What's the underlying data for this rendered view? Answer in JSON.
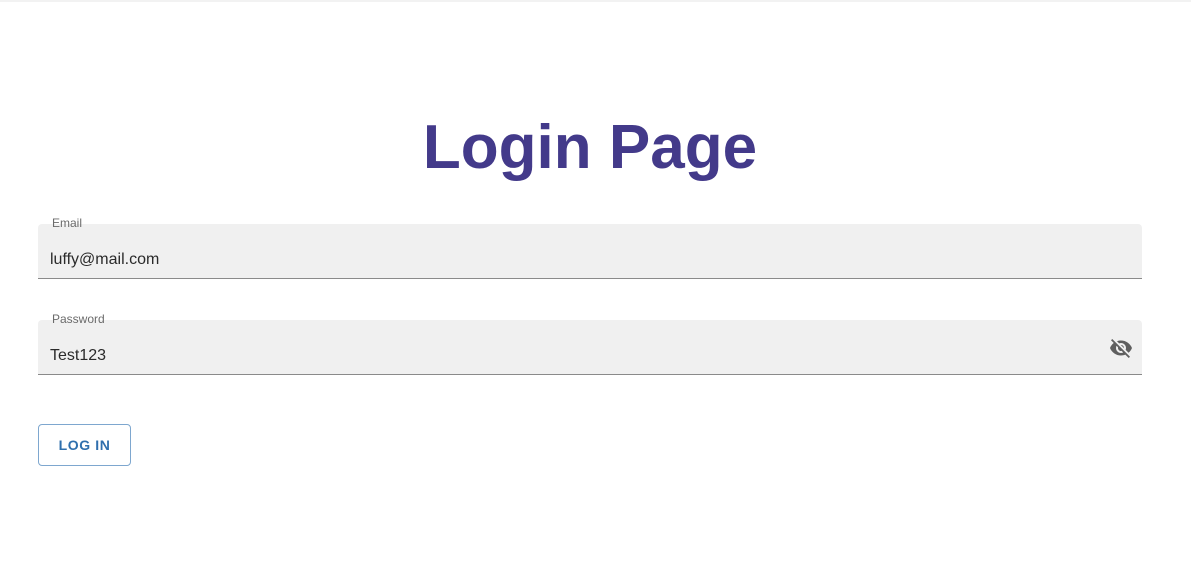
{
  "page": {
    "title": "Login Page"
  },
  "form": {
    "email": {
      "label": "Email",
      "value": "luffy@mail.com"
    },
    "password": {
      "label": "Password",
      "value": "Test123",
      "visibility_icon": "eye-off-icon"
    },
    "submit_label": "LOG IN"
  },
  "colors": {
    "title": "#433a8a",
    "button_text": "#2f6fad",
    "button_border": "#7ea7cf",
    "field_background": "#f0f0f0"
  }
}
